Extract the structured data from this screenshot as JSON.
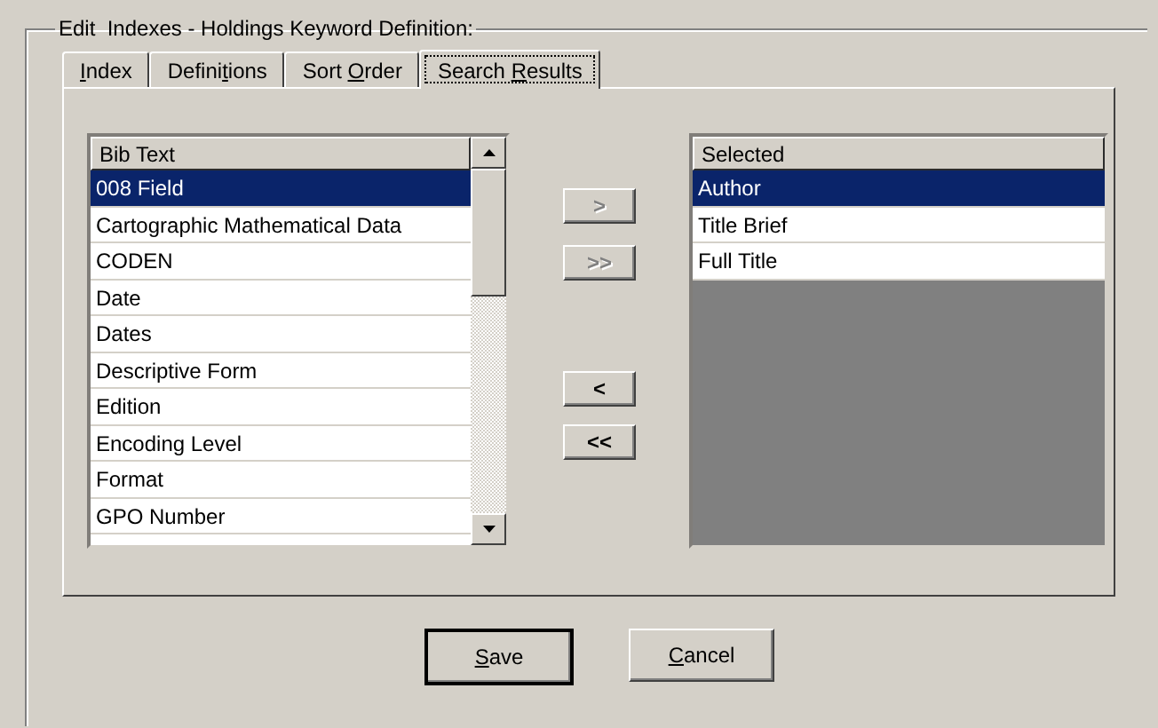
{
  "group_title": "Edit  Indexes - Holdings Keyword Definition:",
  "tabs": [
    {
      "key": "I",
      "post": "ndex",
      "selected": false
    },
    {
      "pre": "Defini",
      "key": "t",
      "post": "ions",
      "selected": false
    },
    {
      "pre": "Sort ",
      "key": "O",
      "post": "rder",
      "selected": false
    },
    {
      "pre": "Search ",
      "key": "R",
      "post": "esults",
      "selected": true
    }
  ],
  "available": {
    "header": "Bib Text",
    "items": [
      {
        "label": "008 Field",
        "selected": true
      },
      {
        "label": "Cartographic Mathematical Data",
        "selected": false
      },
      {
        "label": "CODEN",
        "selected": false
      },
      {
        "label": "Date",
        "selected": false
      },
      {
        "label": "Dates",
        "selected": false
      },
      {
        "label": "Descriptive Form",
        "selected": false
      },
      {
        "label": "Edition",
        "selected": false
      },
      {
        "label": "Encoding Level",
        "selected": false
      },
      {
        "label": "Format",
        "selected": false
      },
      {
        "label": "GPO Number",
        "selected": false
      }
    ]
  },
  "move_buttons": [
    {
      "label": ">",
      "disabled": true
    },
    {
      "label": ">>",
      "disabled": true
    },
    {
      "label": "<",
      "disabled": false
    },
    {
      "label": "<<",
      "disabled": false
    }
  ],
  "chosen": {
    "header": "Selected",
    "items": [
      {
        "label": "Author",
        "selected": true
      },
      {
        "label": "Title Brief",
        "selected": false
      },
      {
        "label": "Full Title",
        "selected": false
      }
    ]
  },
  "buttons": [
    {
      "key": "S",
      "post": "ave",
      "default": true
    },
    {
      "key": "C",
      "post": "ancel",
      "default": false
    }
  ]
}
